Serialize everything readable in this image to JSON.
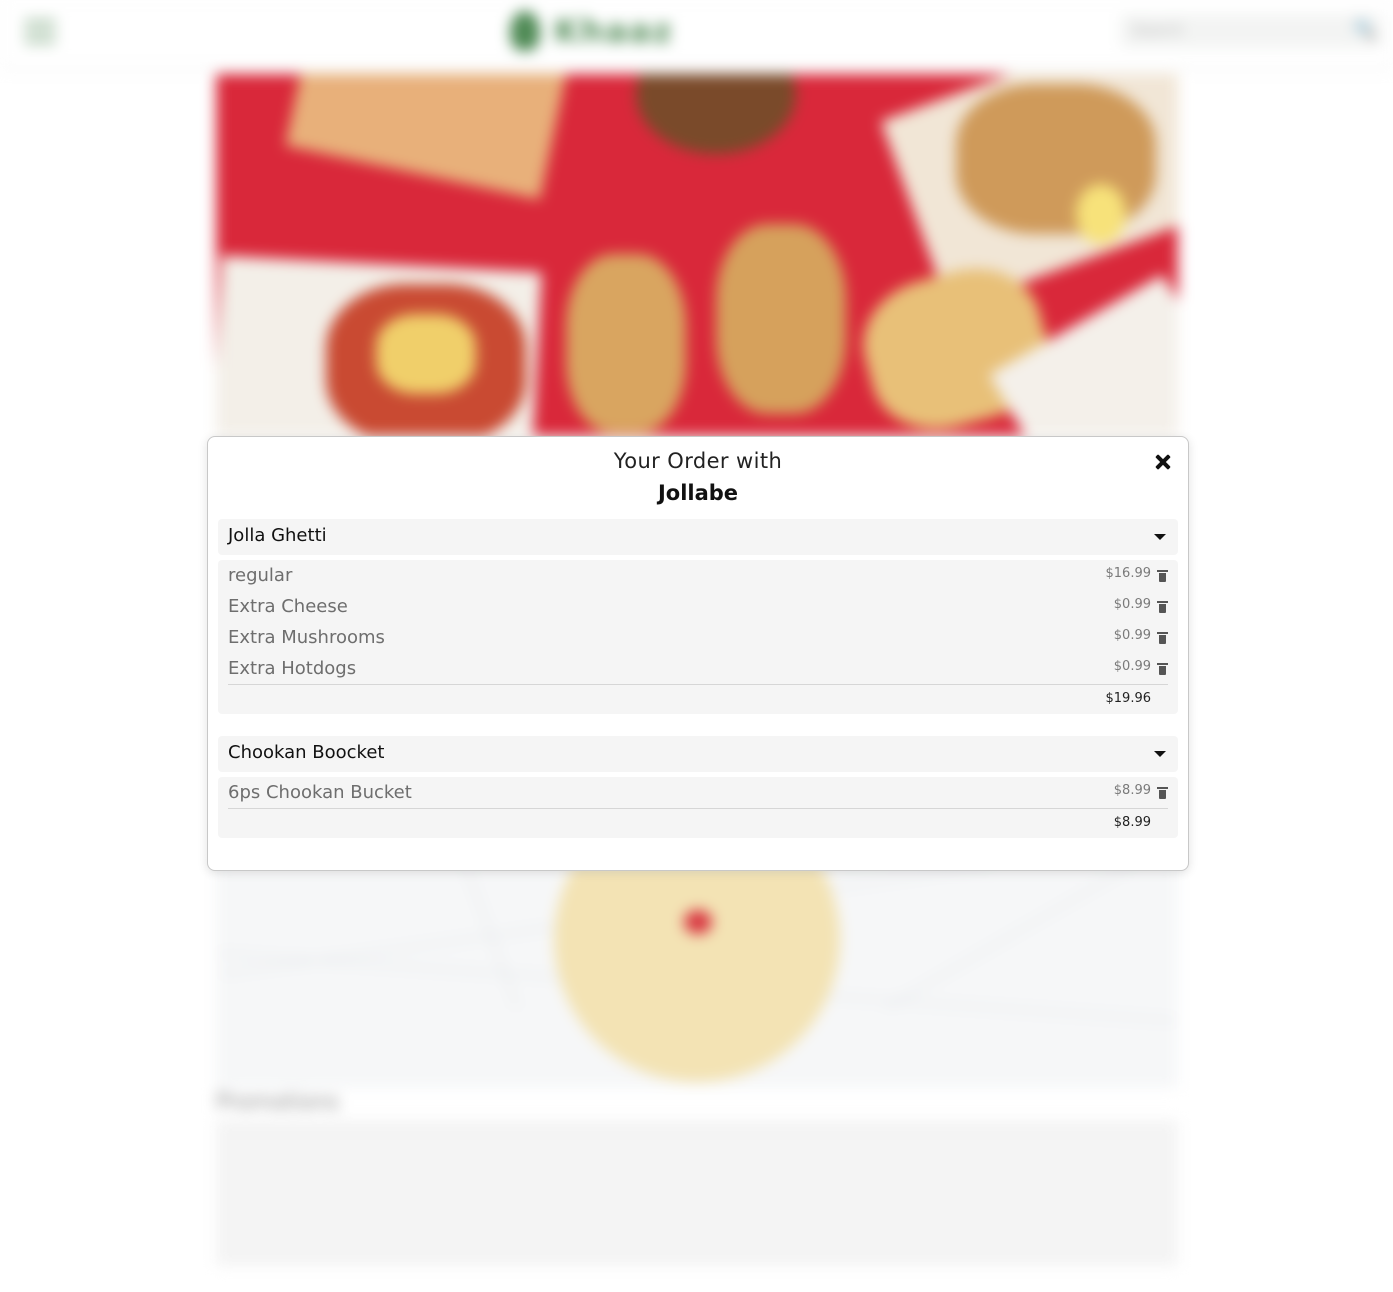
{
  "header": {
    "logo_text": "Khaaz",
    "search_placeholder": "Search"
  },
  "page": {
    "promotions_title": "Promotions"
  },
  "order_modal": {
    "title": "Your Order with",
    "restaurant": "Jollabe",
    "groups": [
      {
        "name": "Jolla Ghetti",
        "items": [
          {
            "label": "regular",
            "price": "$16.99"
          },
          {
            "label": "Extra Cheese",
            "price": "$0.99"
          },
          {
            "label": "Extra Mushrooms",
            "price": "$0.99"
          },
          {
            "label": "Extra Hotdogs",
            "price": "$0.99"
          }
        ],
        "subtotal": "$19.96"
      },
      {
        "name": "Chookan Boocket",
        "items": [
          {
            "label": "6ps Chookan Bucket",
            "price": "$8.99"
          }
        ],
        "subtotal": "$8.99"
      }
    ]
  },
  "colors": {
    "brand_green": "#4f8a55",
    "hero_red": "#d9283a",
    "modal_bg": "#ffffff",
    "row_bg": "#f5f5f5"
  },
  "icons": [
    "hamburger-menu-icon",
    "search-icon",
    "close-icon",
    "chevron-down-icon",
    "trash-icon",
    "map-pin-icon"
  ]
}
